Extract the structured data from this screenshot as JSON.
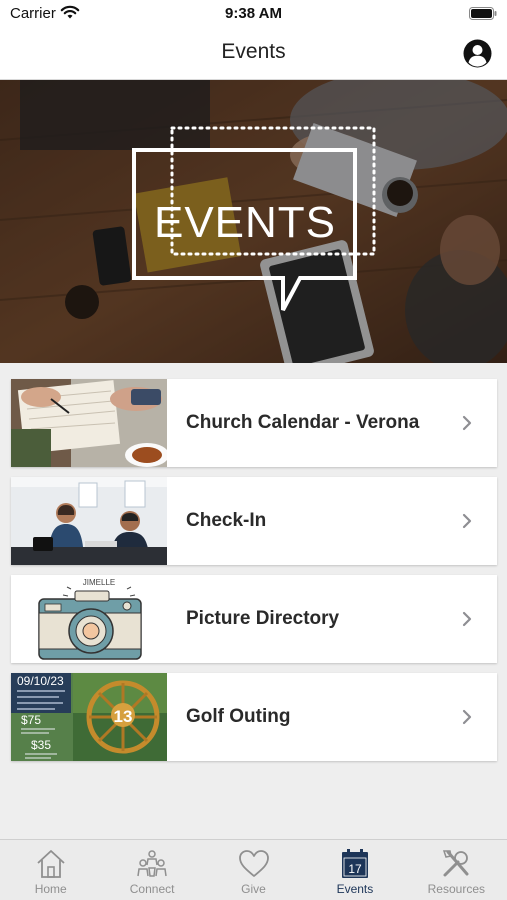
{
  "status_bar": {
    "carrier": "Carrier",
    "time": "9:38 AM"
  },
  "nav": {
    "title": "Events"
  },
  "hero": {
    "banner_text": "EVENTS"
  },
  "events": [
    {
      "label": "Church Calendar - Verona"
    },
    {
      "label": "Check-In"
    },
    {
      "label": "Picture Directory"
    },
    {
      "label": "Golf Outing"
    }
  ],
  "thumbs": {
    "camera_caption": "JIMELLE",
    "golf": {
      "date": "09/10/23",
      "price1": "$75",
      "price2": "$35",
      "badge": "13"
    }
  },
  "tabs": [
    {
      "label": "Home",
      "icon": "home-icon"
    },
    {
      "label": "Connect",
      "icon": "people-icon"
    },
    {
      "label": "Give",
      "icon": "heart-icon"
    },
    {
      "label": "Events",
      "icon": "calendar-icon",
      "calendar_day": "17",
      "active": true
    },
    {
      "label": "Resources",
      "icon": "tools-icon"
    }
  ],
  "colors": {
    "accent": "#1d3558",
    "inactive": "#8f8f8f"
  }
}
